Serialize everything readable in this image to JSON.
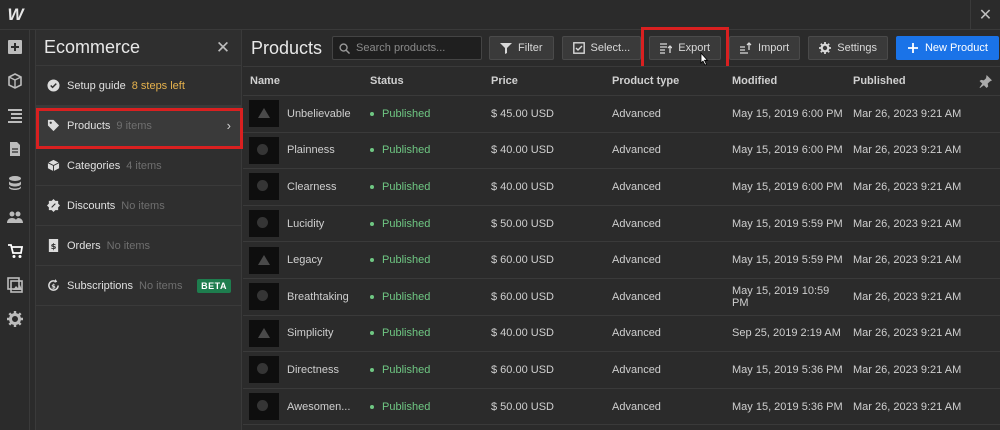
{
  "app": {
    "logo_letter": "W"
  },
  "panel": {
    "title": "Ecommerce",
    "items": [
      {
        "label": "Setup guide",
        "meta": "8 steps left"
      },
      {
        "label": "Products",
        "meta": "9 items"
      },
      {
        "label": "Categories",
        "meta": "4 items"
      },
      {
        "label": "Discounts",
        "meta": "No items"
      },
      {
        "label": "Orders",
        "meta": "No items"
      },
      {
        "label": "Subscriptions",
        "meta": "No items",
        "badge": "BETA"
      }
    ]
  },
  "main": {
    "title": "Products",
    "search_placeholder": "Search products...",
    "buttons": {
      "filter": "Filter",
      "select": "Select...",
      "export": "Export",
      "import": "Import",
      "settings": "Settings",
      "new_product": "New Product"
    }
  },
  "table": {
    "columns": [
      "Name",
      "Status",
      "Price",
      "Product type",
      "Modified",
      "Published"
    ],
    "rows": [
      {
        "name": "Unbelievable",
        "status": "Published",
        "price": "$ 45.00 USD",
        "type": "Advanced",
        "modified": "May 15, 2019 6:00 PM",
        "published": "Mar 26, 2023 9:21 AM",
        "thumb": "triangle"
      },
      {
        "name": "Plainness",
        "status": "Published",
        "price": "$ 40.00 USD",
        "type": "Advanced",
        "modified": "May 15, 2019 6:00 PM",
        "published": "Mar 26, 2023 9:21 AM",
        "thumb": "circle"
      },
      {
        "name": "Clearness",
        "status": "Published",
        "price": "$ 40.00 USD",
        "type": "Advanced",
        "modified": "May 15, 2019 6:00 PM",
        "published": "Mar 26, 2023 9:21 AM",
        "thumb": "circle"
      },
      {
        "name": "Lucidity",
        "status": "Published",
        "price": "$ 50.00 USD",
        "type": "Advanced",
        "modified": "May 15, 2019 5:59 PM",
        "published": "Mar 26, 2023 9:21 AM",
        "thumb": "circle"
      },
      {
        "name": "Legacy",
        "status": "Published",
        "price": "$ 60.00 USD",
        "type": "Advanced",
        "modified": "May 15, 2019 5:59 PM",
        "published": "Mar 26, 2023 9:21 AM",
        "thumb": "triangle"
      },
      {
        "name": "Breathtaking",
        "status": "Published",
        "price": "$ 60.00 USD",
        "type": "Advanced",
        "modified": "May 15, 2019 10:59 PM",
        "published": "Mar 26, 2023 9:21 AM",
        "thumb": "circle"
      },
      {
        "name": "Simplicity",
        "status": "Published",
        "price": "$ 40.00 USD",
        "type": "Advanced",
        "modified": "Sep 25, 2019 2:19 AM",
        "published": "Mar 26, 2023 9:21 AM",
        "thumb": "triangle"
      },
      {
        "name": "Directness",
        "status": "Published",
        "price": "$ 60.00 USD",
        "type": "Advanced",
        "modified": "May 15, 2019 5:36 PM",
        "published": "Mar 26, 2023 9:21 AM",
        "thumb": "circle"
      },
      {
        "name": "Awesomen...",
        "status": "Published",
        "price": "$ 50.00 USD",
        "type": "Advanced",
        "modified": "May 15, 2019 5:36 PM",
        "published": "Mar 26, 2023 9:21 AM",
        "thumb": "circle"
      }
    ]
  },
  "colors": {
    "accent": "#1a73e8",
    "published": "#6fc783",
    "warning": "#e6b24d",
    "beta": "#1e7d4e",
    "highlight": "#d92020"
  }
}
